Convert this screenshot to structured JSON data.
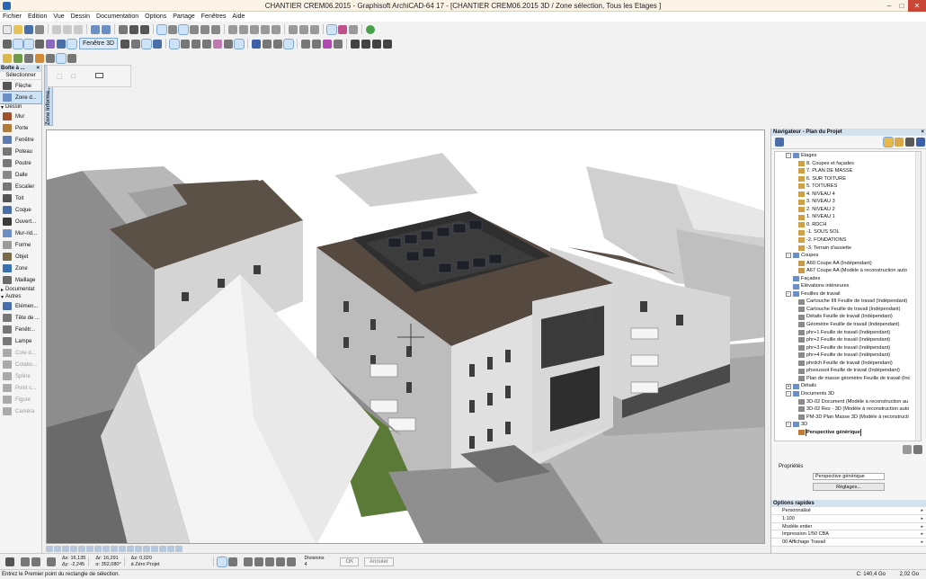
{
  "window": {
    "title": "CHANTIER CREM06.2015 - Graphisoft ArchiCAD-64 17 - [CHANTIER CREM06.2015 3D / Zone sélection, Tous les Etages ]"
  },
  "menu": [
    "Fichier",
    "Edition",
    "Vue",
    "Dessin",
    "Documentation",
    "Options",
    "Partage",
    "Fenêtres",
    "Aide"
  ],
  "toolbar": {
    "view3d_label": "Fenêtre 3D"
  },
  "infobox": {
    "tab_label": "Zone Informa..."
  },
  "toolbox": {
    "title": "Boîte à ...",
    "select_label": "Sélectionner",
    "items": [
      {
        "label": "Flèche",
        "icon": "arrow-icon",
        "state": "normal"
      },
      {
        "label": "Zone d...",
        "icon": "marquee-icon",
        "state": "selected"
      },
      {
        "label": "Dessin",
        "icon": "",
        "state": "group"
      },
      {
        "label": "Mur",
        "icon": "wall-icon",
        "state": "normal"
      },
      {
        "label": "Porte",
        "icon": "door-icon",
        "state": "normal"
      },
      {
        "label": "Fenêtre",
        "icon": "window-icon",
        "state": "normal"
      },
      {
        "label": "Poteau",
        "icon": "column-icon",
        "state": "normal"
      },
      {
        "label": "Poutre",
        "icon": "beam-icon",
        "state": "normal"
      },
      {
        "label": "Dalle",
        "icon": "slab-icon",
        "state": "normal"
      },
      {
        "label": "Escalier",
        "icon": "stair-icon",
        "state": "normal"
      },
      {
        "label": "Toit",
        "icon": "roof-icon",
        "state": "normal"
      },
      {
        "label": "Coque",
        "icon": "shell-icon",
        "state": "normal"
      },
      {
        "label": "Ouvert...",
        "icon": "skylight-icon",
        "state": "normal"
      },
      {
        "label": "Mur-rid...",
        "icon": "curtain-wall-icon",
        "state": "normal"
      },
      {
        "label": "Forme",
        "icon": "morph-icon",
        "state": "normal"
      },
      {
        "label": "Objet",
        "icon": "object-icon",
        "state": "normal"
      },
      {
        "label": "Zone",
        "icon": "zone-icon",
        "state": "normal"
      },
      {
        "label": "Maillage",
        "icon": "mesh-icon",
        "state": "normal"
      },
      {
        "label": "Documentat",
        "icon": "",
        "state": "group-closed"
      },
      {
        "label": "Autres",
        "icon": "",
        "state": "group"
      },
      {
        "label": "Elémen...",
        "icon": "element-icon",
        "state": "normal"
      },
      {
        "label": "Tête de ...",
        "icon": "head-icon",
        "state": "normal"
      },
      {
        "label": "Fenêtr...",
        "icon": "window-corner-icon",
        "state": "normal"
      },
      {
        "label": "Lampe",
        "icon": "lamp-icon",
        "state": "normal"
      },
      {
        "label": "Cote d...",
        "icon": "dimension-icon",
        "state": "disabled"
      },
      {
        "label": "Cotatio...",
        "icon": "level-icon",
        "state": "disabled"
      },
      {
        "label": "Spline",
        "icon": "spline-icon",
        "state": "disabled"
      },
      {
        "label": "Point c...",
        "icon": "hotspot-icon",
        "state": "disabled"
      },
      {
        "label": "Figure",
        "icon": "figure-icon",
        "state": "disabled"
      },
      {
        "label": "Caméra",
        "icon": "camera-icon",
        "state": "disabled"
      }
    ]
  },
  "navigator": {
    "title": "Navigateur - Plan du Projet",
    "tree": [
      {
        "label": "Etages",
        "depth": 1,
        "type": "folder",
        "expand": "-"
      },
      {
        "label": "8. Coupes et façades",
        "depth": 2,
        "type": "story"
      },
      {
        "label": "7. PLAN DE MASSE",
        "depth": 2,
        "type": "story"
      },
      {
        "label": "6. SUR TOITURE",
        "depth": 2,
        "type": "story"
      },
      {
        "label": "5. TOITURES",
        "depth": 2,
        "type": "story"
      },
      {
        "label": "4. NIVEAU 4",
        "depth": 2,
        "type": "story"
      },
      {
        "label": "3. NIVEAU 3",
        "depth": 2,
        "type": "story"
      },
      {
        "label": "2. NIVEAU 2",
        "depth": 2,
        "type": "story"
      },
      {
        "label": "1. NIVEAU 1",
        "depth": 2,
        "type": "story"
      },
      {
        "label": "0. RDCH",
        "depth": 2,
        "type": "story"
      },
      {
        "label": "-1. SOUS SOL",
        "depth": 2,
        "type": "story"
      },
      {
        "label": "-2. FONDATIONS",
        "depth": 2,
        "type": "story"
      },
      {
        "label": "-3. Terrain d'assiette",
        "depth": 2,
        "type": "story"
      },
      {
        "label": "Coupes",
        "depth": 1,
        "type": "folder",
        "expand": "-"
      },
      {
        "label": "A60 Coupe AA (Indépendant)",
        "depth": 2,
        "type": "section"
      },
      {
        "label": "A67 Coupe AA (Modèle à reconstruction auto",
        "depth": 2,
        "type": "section"
      },
      {
        "label": "Façades",
        "depth": 1,
        "type": "folder",
        "expand": ""
      },
      {
        "label": "Elévations intérieures",
        "depth": 1,
        "type": "folder",
        "expand": ""
      },
      {
        "label": "Feuilles de travail",
        "depth": 1,
        "type": "folder",
        "expand": "-"
      },
      {
        "label": "Cartouche IIII Feuille de travail (Indépendant)",
        "depth": 2,
        "type": "sheet"
      },
      {
        "label": "Cartouche Feuille de travail (Indépendant)",
        "depth": 2,
        "type": "sheet"
      },
      {
        "label": "Détails Feuille de travail (Indépendant)",
        "depth": 2,
        "type": "sheet"
      },
      {
        "label": "Géomètre Feuille de travail (Indépendant)",
        "depth": 2,
        "type": "sheet"
      },
      {
        "label": "phr+1 Feuille de travail (Indépendant)",
        "depth": 2,
        "type": "sheet"
      },
      {
        "label": "phr+2 Feuille de travail (Indépendant)",
        "depth": 2,
        "type": "sheet"
      },
      {
        "label": "phr+3 Feuille de travail (Indépendant)",
        "depth": 2,
        "type": "sheet"
      },
      {
        "label": "phr+4 Feuille de travail (Indépendant)",
        "depth": 2,
        "type": "sheet"
      },
      {
        "label": "phrdch Feuille de travail (Indépendant)",
        "depth": 2,
        "type": "sheet"
      },
      {
        "label": "phsoussol Feuille de travail (Indépendant)",
        "depth": 2,
        "type": "sheet"
      },
      {
        "label": "Plan de masse géomètre Feuille de travail (Inc",
        "depth": 2,
        "type": "sheet"
      },
      {
        "label": "Détails",
        "depth": 1,
        "type": "folder",
        "expand": "+"
      },
      {
        "label": "Documents 3D",
        "depth": 1,
        "type": "folder",
        "expand": "-"
      },
      {
        "label": "3D-02 Document (Modèle à reconstruction au",
        "depth": 2,
        "type": "doc3d"
      },
      {
        "label": "3D-02 Rez - 3D (Modèle à reconstruction auto",
        "depth": 2,
        "type": "doc3d"
      },
      {
        "label": "PM-3D Plan Masse 3D (Modèle à reconstructi",
        "depth": 2,
        "type": "doc3d"
      },
      {
        "label": "3D",
        "depth": 1,
        "type": "folder",
        "expand": "-"
      },
      {
        "label": "Perspective générique",
        "depth": 2,
        "type": "persp",
        "selected": true
      }
    ]
  },
  "properties": {
    "title": "Propriétés",
    "name_value": "Perspective générique",
    "settings_button": "Réglages..."
  },
  "quick_options": {
    "title": "Options rapides",
    "rows": [
      "Personnalisé",
      "1:100",
      "Modèle entier",
      "Impression 1/50 CBA",
      "00 Affichage Travail"
    ]
  },
  "coords": {
    "dx_label": "Δx:",
    "dx": "16,135",
    "dy_label": "Δy:",
    "dy": "-2,245",
    "dr_label": "Δr:",
    "dr": "16,291",
    "da_label": "α:",
    "da": "352,080°",
    "dz_label": "Δz:",
    "dz": "0,020",
    "ref": "à Zéro Projet",
    "divisions_label": "Divisions",
    "divisions_value": "4",
    "ok": "OK",
    "cancel": "Annuler"
  },
  "status": {
    "message": "Entrez le Premier point du rectangle de sélection.",
    "disk": "C: 140,4 Go",
    "memory": "2,02 Go"
  },
  "colors": {
    "accent": "#7ba7d9",
    "panel_header": "#d4e1ef",
    "selected_bg": "#cfe3f7",
    "close_button": "#c94637"
  }
}
